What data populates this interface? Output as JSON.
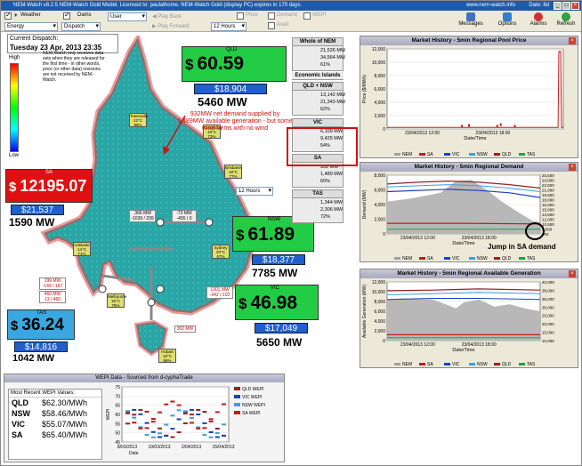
{
  "window": {
    "title": "NEM-Watch v8.2.5 NEM-Watch Gold Model.  Licensed to: paulathome.  NEM-Watch Gold (display PC) expires in 170 days.",
    "url": "www.nem-watch.info",
    "date_label": "Date: 8d"
  },
  "toolbar": {
    "weather_label": "Weather",
    "dams_label": "Dams",
    "energy_label": "Energy",
    "dispatch_label": "Dispatch",
    "user_label": "User",
    "play_back_label": "Play Back",
    "play_forward_label": "Play Forward",
    "hours_label": "12 Hours",
    "price_label": "Price",
    "demand_label": "Demand",
    "avail_label": "Avail",
    "wepi_label": "WEPI",
    "messages_label": "Messages",
    "options_label": "Options",
    "alarms_label": "Alarms",
    "refresh_label": "Refresh",
    "colors": {
      "green": "#1a9b2a",
      "blue": "#2b59c3",
      "grey": "#9a9a9a",
      "gold": "#e0a020"
    }
  },
  "dispatch": {
    "label": "Current Dispatch:",
    "datetime": "Tuesday 23 Apr, 2013 23:35"
  },
  "legend": {
    "high": "High",
    "low": "Low"
  },
  "notice": "NEM-Watch only receives data sets when they are released for the first time - in other words, price (or other data) revisions are not received by NEM-Watch.",
  "regions": {
    "qld": {
      "name": "QLD",
      "price": "60.59",
      "avg": "$18,904",
      "demand": "5460 MW",
      "color": "#22cc44"
    },
    "sa": {
      "name": "SA",
      "price": "12195.07",
      "avg": "$21,537",
      "demand": "1590 MW",
      "color": "#e01010"
    },
    "nsw": {
      "name": "NSW",
      "price": "61.89",
      "avg": "$18,377",
      "demand": "7785 MW",
      "color": "#22cc44"
    },
    "vic": {
      "name": "VIC",
      "price": "46.98",
      "avg": "$17,049",
      "demand": "5650 MW",
      "color": "#22cc44"
    },
    "tas": {
      "name": "TAS",
      "price": "36.24",
      "avg": "$14,816",
      "demand": "1042 MW",
      "color": "#3aa8e0"
    }
  },
  "currency_symbol": "$",
  "annotation_main": "932MW net demand supplied by 1,489MW available generation - but some wind farms with no wind",
  "annotation_jump": "Jump in SA demand",
  "map": {
    "flows": [
      {
        "label": ".366 MW",
        "sub": "-1039 / 209"
      },
      {
        "label": "-73 MW",
        "sub": "-455 / 0"
      },
      {
        "label": "199 MW",
        "sub": "-149 / 167"
      },
      {
        "label": "460 MW",
        "sub": "13 / 460"
      },
      {
        "label": "1001 MW",
        "sub": "-342 / 102"
      },
      {
        "label": "302 MW",
        "sub": ""
      }
    ],
    "weather": [
      {
        "name": "Townsville",
        "temp": "23°C",
        "rh": "99%"
      },
      {
        "name": "Gladstone",
        "temp": "19°C",
        "rh": "73%"
      },
      {
        "name": "Brisbane",
        "temp": "19°C",
        "rh": "77%"
      },
      {
        "name": "Adelaide",
        "temp": "14°C",
        "rh": "71%"
      },
      {
        "name": "Sydney",
        "temp": "20°C",
        "rh": "67%"
      },
      {
        "name": "Melbourne",
        "temp": "15°C",
        "rh": "75%"
      },
      {
        "name": "Hobart",
        "temp": "10°C",
        "rh": "96%"
      }
    ],
    "hours_label": "12 Hours"
  },
  "summary": {
    "whole": {
      "title": "Whole of NEM",
      "rows": [
        "21,526 MW",
        "34,564 MW",
        "61%"
      ]
    },
    "eco_title": "Economic Islands",
    "qldnsw": {
      "title": "QLD + NSW",
      "rows": [
        "13,142 MW",
        "21,343 MW",
        "62%"
      ]
    },
    "vic": {
      "title": "VIC",
      "rows": [
        "6,109 MW",
        "9,425 MW",
        "54%"
      ]
    },
    "sa": {
      "title": "SA",
      "rows": [
        "932 MW",
        "1,489 MW",
        "60%"
      ]
    },
    "tas": {
      "title": "TAS",
      "rows": [
        "1,344 MW",
        "2,306 MW",
        "72%"
      ]
    }
  },
  "charts": {
    "price": {
      "title": "Market History - 5min Regional Pool Price",
      "ylabel": "Price ($/MWh)",
      "xlabel": "Date/Time",
      "yticks": [
        "12,000",
        "10,000",
        "8,000",
        "6,000",
        "4,000",
        "2,000",
        "0"
      ],
      "xticks": [
        "23/04/2013 12:00",
        "23/04/2013 18:00"
      ],
      "legend": [
        "NEM",
        "SA",
        "VIC",
        "NSW",
        "QLD",
        "TAS"
      ]
    },
    "demand": {
      "title": "Market History - 5min Regional Demand",
      "ylabel": "Demand (MW)",
      "xlabel": "Date/Time",
      "yticks": [
        "8,000",
        "6,000",
        "4,000",
        "2,000",
        "0"
      ],
      "yticks_right": [
        "25,500",
        "24,000",
        "22,500",
        "21,000",
        "19,500",
        "18,000",
        "16,500",
        "15,000",
        "13,500",
        "12,000",
        "10,500",
        "9,000",
        "500"
      ],
      "xticks": [
        "23/04/2013 12:00",
        "23/04/2013 18:00"
      ],
      "legend": [
        "NEM",
        "SA",
        "VIC",
        "NSW",
        "QLD",
        "TAS"
      ]
    },
    "avail": {
      "title": "Market History - 5min Regional Available Generation",
      "ylabel": "Available Generation (MW)",
      "xlabel": "Date/Time",
      "yticks": [
        "12,000",
        "10,000",
        "8,000",
        "6,000",
        "4,000",
        "2,000",
        "0"
      ],
      "yticks_right": [
        "40,000",
        "38,000",
        "35,000",
        "30,000",
        "25,000",
        "20,000",
        "15,000",
        "10,000"
      ],
      "xticks": [
        "23/04/2013 12:00",
        "23/04/2013 18:00"
      ],
      "legend": [
        "NEM",
        "SA",
        "VIC",
        "NSW",
        "QLD",
        "TAS"
      ]
    },
    "series_colors": {
      "NEM": "#a0a0a0",
      "SA": "#c81818",
      "VIC": "#1a3fc0",
      "NSW": "#3aa0e0",
      "QLD": "#9a2020",
      "TAS": "#20a040"
    }
  },
  "wepi": {
    "title": "WEPI Data - Sourced from d-cyphaTrade",
    "table_title": "Most Recent WEPI Values:",
    "rows": [
      {
        "region": "QLD",
        "value": "$62.30/MWh"
      },
      {
        "region": "NSW",
        "value": "$58.46/MWh"
      },
      {
        "region": "VIC",
        "value": "$55.07/MWh"
      },
      {
        "region": "SA",
        "value": "$65.40/MWh"
      }
    ],
    "ylabel": "WEPI",
    "xlabel": "Date",
    "yticks": [
      "75",
      "70",
      "65",
      "60",
      "55",
      "50",
      "45"
    ],
    "xticks": [
      "8/03/2013",
      "19/03/2013",
      "2/04/2013",
      "15/04/2013"
    ],
    "legend": [
      "QLD WEPI",
      "VIC WEPI",
      "NSW WEPI",
      "SA WEPI"
    ]
  }
}
